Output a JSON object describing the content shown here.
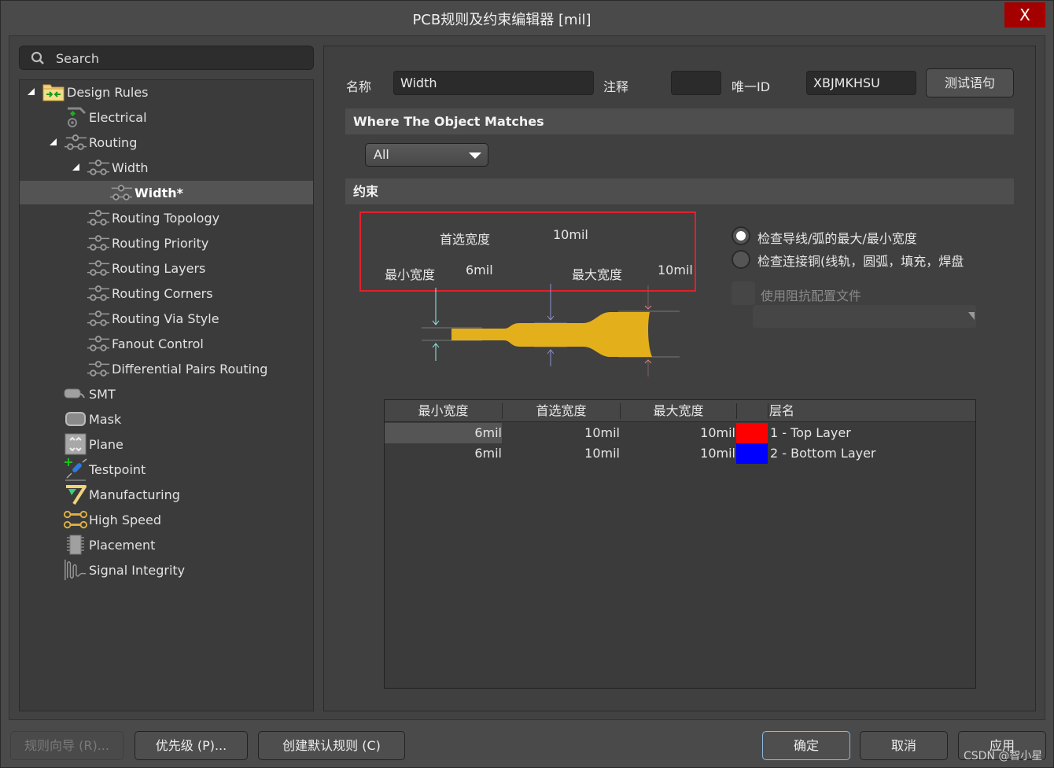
{
  "window": {
    "title": "PCB规则及约束编辑器 [mil]",
    "close_label": "X"
  },
  "search": {
    "placeholder": "Search"
  },
  "tree": {
    "items": [
      {
        "label": "Design Rules",
        "icon": "folder-rules-icon",
        "expanded": true,
        "level": 0
      },
      {
        "label": "Electrical",
        "icon": "electrical-icon",
        "expanded": false,
        "level": 1
      },
      {
        "label": "Routing",
        "icon": "routing-icon",
        "expanded": true,
        "level": 1
      },
      {
        "label": "Width",
        "icon": "routing-icon",
        "expanded": true,
        "level": 2
      },
      {
        "label": "Width*",
        "icon": "routing-icon",
        "selected": true,
        "level": 3
      },
      {
        "label": "Routing Topology",
        "icon": "routing-icon",
        "expanded": false,
        "level": 2
      },
      {
        "label": "Routing Priority",
        "icon": "routing-icon",
        "expanded": false,
        "level": 2
      },
      {
        "label": "Routing Layers",
        "icon": "routing-icon",
        "expanded": false,
        "level": 2
      },
      {
        "label": "Routing Corners",
        "icon": "routing-icon",
        "expanded": false,
        "level": 2
      },
      {
        "label": "Routing Via Style",
        "icon": "routing-icon",
        "expanded": false,
        "level": 2
      },
      {
        "label": "Fanout Control",
        "icon": "routing-icon",
        "expanded": false,
        "level": 2
      },
      {
        "label": "Differential Pairs Routing",
        "icon": "routing-icon",
        "expanded": false,
        "level": 2
      },
      {
        "label": "SMT",
        "icon": "smt-icon",
        "expanded": false,
        "level": 1
      },
      {
        "label": "Mask",
        "icon": "mask-icon",
        "expanded": false,
        "level": 1
      },
      {
        "label": "Plane",
        "icon": "plane-icon",
        "expanded": false,
        "level": 1
      },
      {
        "label": "Testpoint",
        "icon": "testpoint-icon",
        "expanded": false,
        "level": 1
      },
      {
        "label": "Manufacturing",
        "icon": "manufacturing-icon",
        "expanded": false,
        "level": 1
      },
      {
        "label": "High Speed",
        "icon": "high-speed-icon",
        "expanded": false,
        "level": 1
      },
      {
        "label": "Placement",
        "icon": "placement-icon",
        "expanded": false,
        "level": 1
      },
      {
        "label": "Signal Integrity",
        "icon": "signal-integrity-icon",
        "expanded": false,
        "level": 1
      }
    ]
  },
  "rule": {
    "name_label": "名称",
    "name_value": "Width",
    "comment_label": "注释",
    "comment_value": "",
    "uid_label": "唯一ID",
    "uid_value": "XBJMKHSU",
    "test_button": "测试语句"
  },
  "match": {
    "header": "Where The Object Matches",
    "selected": "All"
  },
  "constraints": {
    "header": "约束",
    "preferred_label": "首选宽度",
    "preferred_value": "10mil",
    "min_label": "最小宽度",
    "min_value": "6mil",
    "max_label": "最大宽度",
    "max_value": "10mil",
    "radio_options": [
      {
        "label": "检查导线/弧的最大/最小宽度",
        "checked": true
      },
      {
        "label": "检查连接铜(线轨，圆弧，填充，焊盘",
        "checked": false
      }
    ],
    "impedance_checkbox": {
      "label": "使用阻抗配置文件",
      "checked": false,
      "disabled": true
    },
    "trace_color": "#e3b01c"
  },
  "layer_table": {
    "columns": [
      "最小宽度",
      "首选宽度",
      "最大宽度",
      "",
      "层名"
    ],
    "rows": [
      {
        "min": "6mil",
        "preferred": "10mil",
        "max": "10mil",
        "color": "#ff0000",
        "layer": "1 - Top Layer"
      },
      {
        "min": "6mil",
        "preferred": "10mil",
        "max": "10mil",
        "color": "#0000ff",
        "layer": "2 - Bottom Layer"
      }
    ]
  },
  "footer": {
    "rule_wizard": "规则向导 (R)...",
    "priorities": "优先级 (P)...",
    "create_default": "创建默认规则 (C)",
    "ok": "确定",
    "cancel": "取消",
    "apply": "应用"
  },
  "watermark": "CSDN @智小星"
}
